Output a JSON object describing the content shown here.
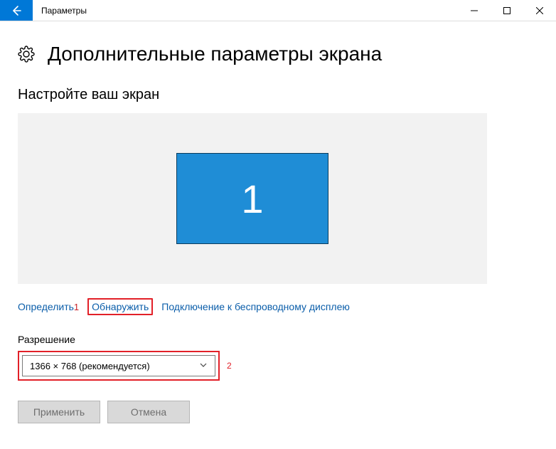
{
  "titlebar": {
    "title": "Параметры"
  },
  "heading": "Дополнительные параметры экрана",
  "section": "Настройте ваш экран",
  "monitor": {
    "number": "1"
  },
  "links": {
    "identify": "Определить",
    "detect": "Обнаружить",
    "wireless": "Подключение к беспроводному дисплею"
  },
  "annotations": {
    "one": "1",
    "two": "2"
  },
  "resolution": {
    "label": "Разрешение",
    "value": "1366 × 768 (рекомендуется)"
  },
  "buttons": {
    "apply": "Применить",
    "cancel": "Отмена"
  }
}
